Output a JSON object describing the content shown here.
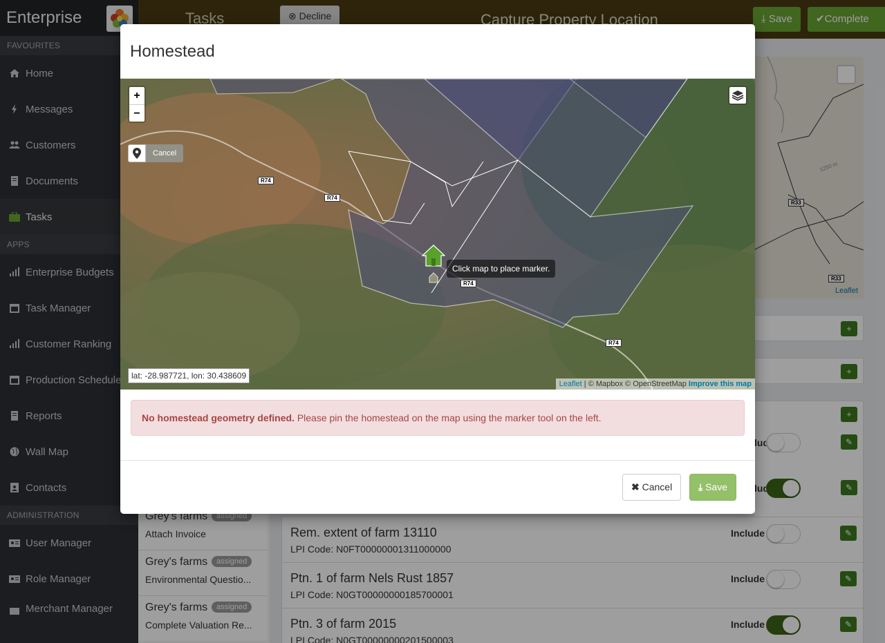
{
  "sidebar": {
    "brand": "Enterprise",
    "sections": {
      "favourites": "FAVOURITES",
      "apps": "APPS",
      "administration": "ADMINISTRATION"
    },
    "items": [
      {
        "label": "Home",
        "icon": "home-icon"
      },
      {
        "label": "Messages",
        "icon": "bolt-icon"
      },
      {
        "label": "Customers",
        "icon": "users-icon"
      },
      {
        "label": "Documents",
        "icon": "file-icon"
      },
      {
        "label": "Tasks",
        "icon": "briefcase-icon"
      },
      {
        "label": "Enterprise Budgets",
        "icon": "bar-chart-icon"
      },
      {
        "label": "Task Manager",
        "icon": "calendar-icon"
      },
      {
        "label": "Customer Ranking",
        "icon": "bar-chart-icon"
      },
      {
        "label": "Production Schedule",
        "icon": "calendar-icon"
      },
      {
        "label": "Reports",
        "icon": "file-icon"
      },
      {
        "label": "Wall Map",
        "icon": "globe-icon"
      },
      {
        "label": "Contacts",
        "icon": "address-book-icon"
      },
      {
        "label": "User Manager",
        "icon": "id-card-icon"
      },
      {
        "label": "Role Manager",
        "icon": "id-card-icon"
      },
      {
        "label": "Merchant Manager",
        "icon": "store-icon"
      }
    ]
  },
  "background": {
    "tasks_title": "Tasks",
    "decline_label": "Decline",
    "page_title": "Capture Property Location",
    "save_label": "Save",
    "complete_label": "Complete",
    "map_leaflet": "Leaflet",
    "map_road_r33": "R33",
    "map_contour": "1250 m",
    "task_list": [
      {
        "farm": "Grey's farms",
        "badge": "assigned",
        "task": "Attach Invoice"
      },
      {
        "farm": "Grey's farms",
        "badge": "assigned",
        "task": "Environmental Questio..."
      },
      {
        "farm": "Grey's farms",
        "badge": "assigned",
        "task": "Complete Valuation Re..."
      }
    ],
    "properties": [
      {
        "name": "Rem. extent of farm 13110",
        "lpi": "LPI Code: N0FT00000001311000000",
        "include": "Include",
        "on": false
      },
      {
        "name": "Ptn. 1 of farm Nels Rust 1857",
        "lpi": "LPI Code: N0GT00000000185700001",
        "include": "Include",
        "on": false
      },
      {
        "name": "Ptn. 3 of farm 2015",
        "lpi": "LPI Code: N0GT00000000201500003",
        "include": "Include",
        "on": true
      }
    ],
    "partial_include_1": "lude",
    "partial_include_2": "lude"
  },
  "modal": {
    "title": "Homestead",
    "map": {
      "zoom_in": "+",
      "zoom_out": "−",
      "draw_cancel": "Cancel",
      "tooltip": "Click map to place marker.",
      "coords": "lat: -28.987721, lon: 30.438609",
      "road_label": "R74",
      "attribution": {
        "leaflet": "Leaflet",
        "sep": "|",
        "mapbox": "© Mapbox © OpenStreetMap",
        "improve": "Improve this map"
      }
    },
    "alert": {
      "strong": "No homestead geometry defined.",
      "text": " Please pin the homestead on the map using the marker tool on the left."
    },
    "cancel_label": "Cancel",
    "save_label": "Save"
  },
  "colors": {
    "accent_green": "#6aa533",
    "sidebar_bg": "#2d3034",
    "alert_text": "#a94442",
    "alert_bg": "#f2dede",
    "save_disabled": "#95c06a"
  }
}
